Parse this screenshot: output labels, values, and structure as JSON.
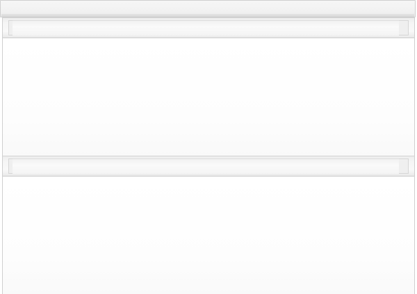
{
  "scene": {
    "subject": "vanity-cabinet",
    "colors": {
      "background": "#ffffff",
      "cabinet_finish": "#fdfdfd",
      "outline": "#cfcfcf"
    },
    "drawers": [
      {
        "id": "upper"
      },
      {
        "id": "lower"
      }
    ]
  }
}
